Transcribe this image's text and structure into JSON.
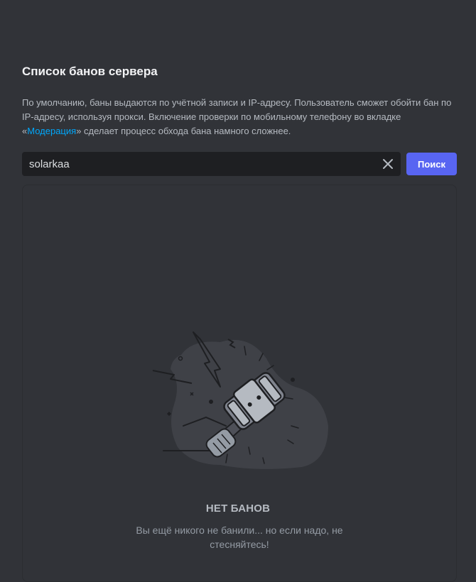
{
  "header": {
    "title": "Список банов сервера"
  },
  "description": {
    "text_before": "По умолчанию, баны выдаются по учётной записи и IP-адресу. Пользователь сможет обойти бан по IP-адресу, используя прокси. Включение проверки по мобильному телефону во вкладке «",
    "link": "Модерация",
    "text_after": "» сделает процесс обхода бана намного сложнее."
  },
  "search": {
    "value": "solarkaa",
    "button_label": "Поиск",
    "clear_icon": "close-icon"
  },
  "empty_state": {
    "title": "НЕТ БАНОВ",
    "subtitle": "Вы ещё никого не банили... но если надо, не стесняйтесь!",
    "illustration_icon": "ban-hammer-icon"
  },
  "colors": {
    "background": "#313338",
    "input_bg": "#1e1f22",
    "accent": "#5865f2",
    "link": "#00a8fc"
  }
}
